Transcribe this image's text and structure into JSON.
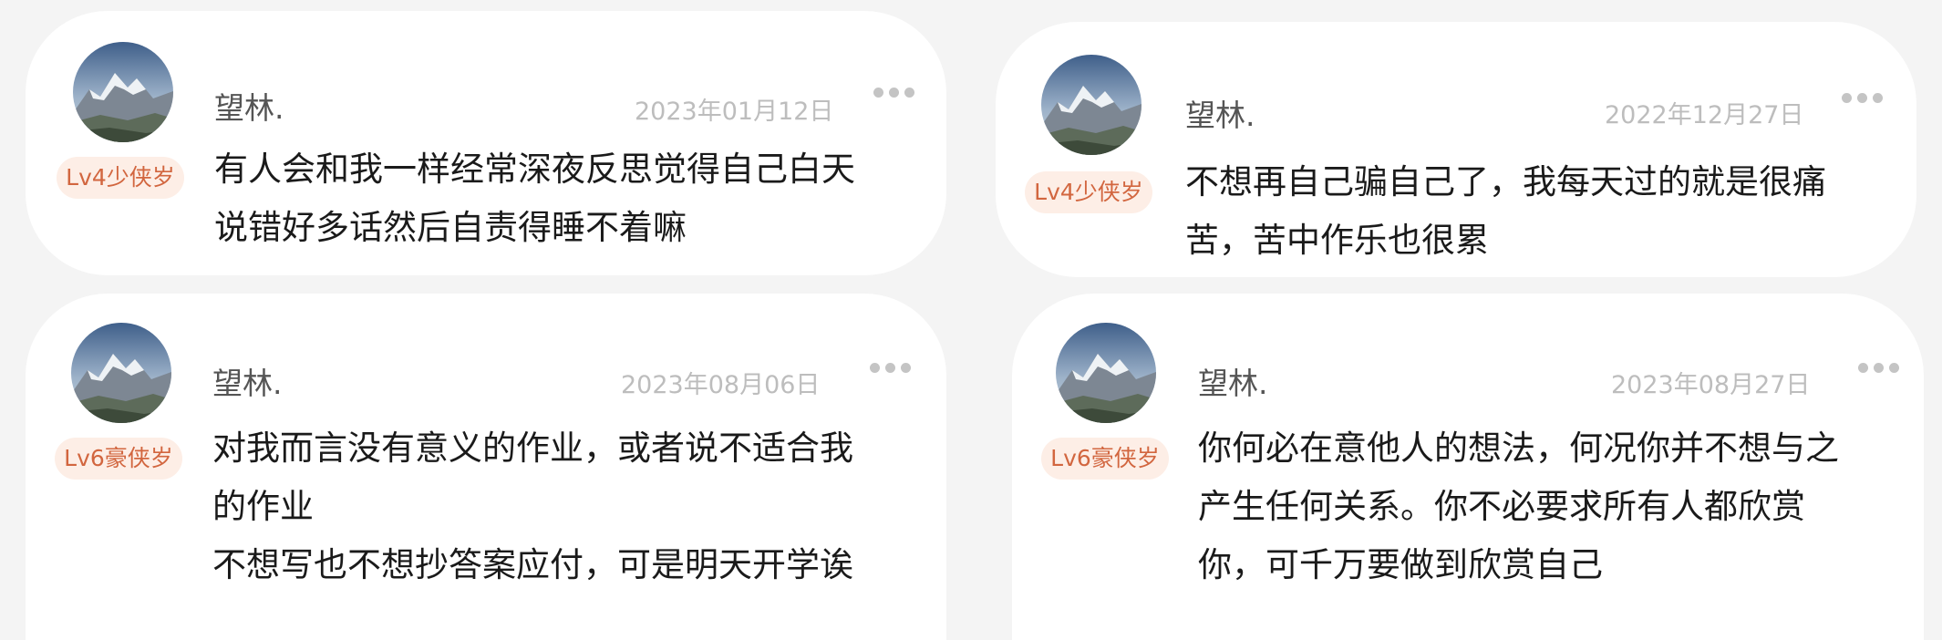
{
  "comments": [
    {
      "username": "望林.",
      "badge": "Lv4少侠岁",
      "date": "2023年01月12日",
      "lines": [
        "有人会和我一样经常深夜反思觉得自己白天",
        "说错好多话然后自责得睡不着嘛"
      ]
    },
    {
      "username": "望林.",
      "badge": "Lv4少侠岁",
      "date": "2022年12月27日",
      "lines": [
        "不想再自己骗自己了，我每天过的就是很痛",
        "苦，苦中作乐也很累"
      ]
    },
    {
      "username": "望林.",
      "badge": "Lv6豪侠岁",
      "date": "2023年08月06日",
      "lines": [
        "对我而言没有意义的作业，或者说不适合我",
        "的作业",
        "不想写也不想抄答案应付，可是明天开学诶"
      ]
    },
    {
      "username": "望林.",
      "badge": "Lv6豪侠岁",
      "date": "2023年08月27日",
      "lines": [
        "你何必在意他人的想法，何况你并不想与之",
        "产生任何关系。你不必要求所有人都欣赏",
        "你，可千万要做到欣赏自己"
      ]
    }
  ],
  "icons": {
    "avatar": "mountain-avatar-icon",
    "more": "more-options-icon"
  },
  "colors": {
    "badge_bg": "#fdeee6",
    "badge_text": "#d2663f",
    "date": "#bdbdbd",
    "username": "#555555",
    "text": "#1a1a1a"
  }
}
